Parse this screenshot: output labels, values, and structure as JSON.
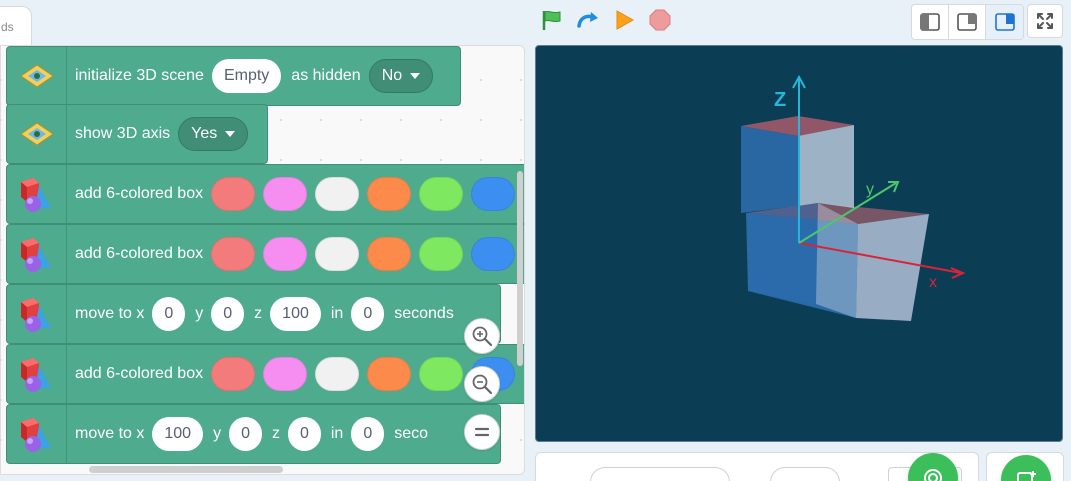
{
  "tab_stub": {
    "label": "ds"
  },
  "run_controls": {
    "icons": [
      "green-flag-icon",
      "redo-icon",
      "play-icon",
      "stop-icon"
    ]
  },
  "view_toggles": [
    "small-stage-icon",
    "large-stage-icon",
    "float-stage-icon"
  ],
  "blocks": [
    {
      "id": "init",
      "label": "initialize 3D scene",
      "value": "Empty",
      "label2": "as hidden",
      "dropdown": "No"
    },
    {
      "id": "axis",
      "label": "show 3D axis",
      "dropdown": "Yes"
    },
    {
      "id": "box1",
      "label": "add 6-colored box",
      "colors": [
        "#f47b7b",
        "#f58ef0",
        "#f1f1f1",
        "#fb8a4b",
        "#7fe861",
        "#3c8ff1"
      ]
    },
    {
      "id": "box2",
      "label": "add 6-colored box",
      "colors": [
        "#f47b7b",
        "#f58ef0",
        "#f1f1f1",
        "#fb8a4b",
        "#7fe861",
        "#3c8ff1"
      ]
    },
    {
      "id": "move1",
      "label": "move to x",
      "x": "0",
      "ylbl": "y",
      "y": "0",
      "zlbl": "z",
      "z": "100",
      "inlbl": "in",
      "t": "0",
      "tail": "seconds"
    },
    {
      "id": "box3",
      "label": "add 6-colored box",
      "colors": [
        "#f47b7b",
        "#f58ef0",
        "#f1f1f1",
        "#fb8a4b",
        "#7fe861",
        "#3c8ff1"
      ]
    },
    {
      "id": "move2",
      "label": "move to x",
      "x": "100",
      "ylbl": "y",
      "y": "0",
      "zlbl": "z",
      "z": "0",
      "inlbl": "in",
      "t": "0",
      "tail": "seco"
    }
  ],
  "stage": {
    "axis_labels": {
      "x": "x",
      "y": "y",
      "z": "Z"
    },
    "background": "#0b3d55"
  },
  "colors": {
    "block_green": "#4eab8e",
    "accent_blue": "#4c97ff"
  }
}
